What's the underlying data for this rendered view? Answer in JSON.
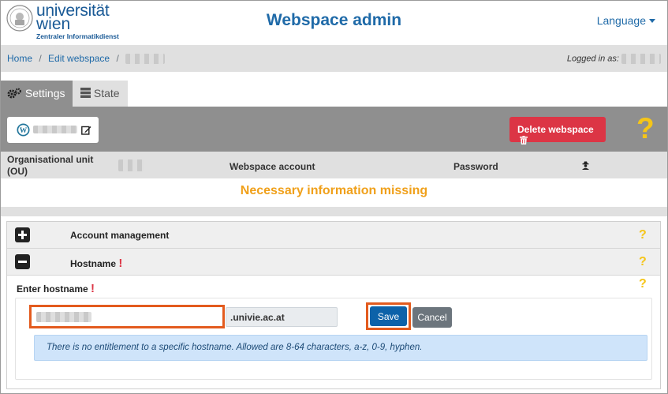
{
  "header": {
    "logo_line1": "universität",
    "logo_line2": "wien",
    "logo_sub": "Zentraler Informatikdienst",
    "title": "Webspace admin",
    "language_label": "Language"
  },
  "breadcrumb": {
    "home": "Home",
    "edit": "Edit webspace",
    "separator": "/",
    "logged_in_label": "Logged in as:"
  },
  "tabs": [
    {
      "label": "Settings",
      "icon": "cogs-icon",
      "active": true
    },
    {
      "label": "State",
      "icon": "server-icon",
      "active": false
    }
  ],
  "toolbar": {
    "delete_label": "Delete webspace",
    "help_icon": "question-mark-icon"
  },
  "info_row": {
    "ou_label": "Organisational unit (OU)",
    "account_label": "Webspace account",
    "password_label": "Password"
  },
  "warning": "Necessary information missing",
  "accordion": {
    "account_management": "Account management",
    "hostname": "Hostname",
    "enter_hostname": "Enter hostname",
    "hostname_suffix": ".univie.ac.at",
    "save_label": "Save",
    "cancel_label": "Cancel",
    "info_text": "There is no entitlement to a specific hostname. Allowed are 8-64 characters, a-z, 0-9, hyphen."
  },
  "colors": {
    "brand_blue": "#1f6aa8",
    "danger": "#dc3545",
    "warning_orange": "#f0a01a",
    "help_yellow": "#f5c518",
    "highlight": "#e35b1e"
  }
}
